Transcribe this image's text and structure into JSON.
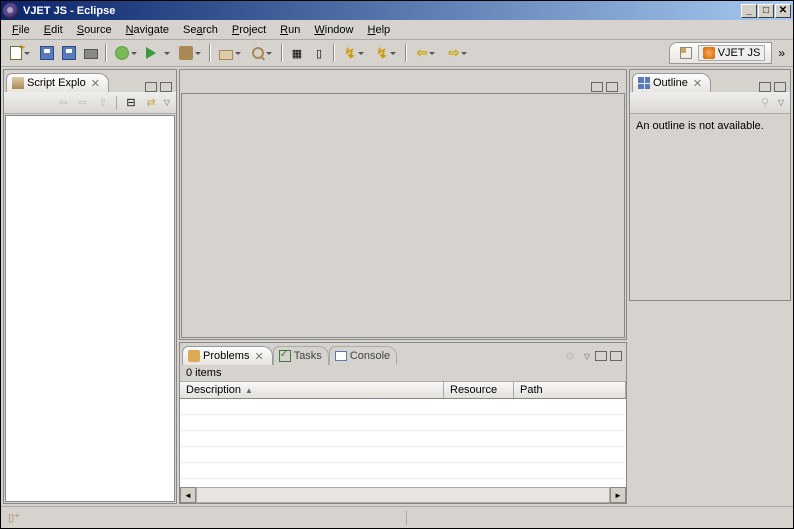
{
  "window": {
    "title": "VJET JS - Eclipse"
  },
  "menu": {
    "file": "File",
    "edit": "Edit",
    "source": "Source",
    "navigate": "Navigate",
    "search": "Search",
    "project": "Project",
    "run": "Run",
    "window": "Window",
    "help": "Help"
  },
  "perspective": {
    "label": "VJET JS"
  },
  "views": {
    "scriptExplorer": {
      "title": "Script Explo"
    },
    "outline": {
      "title": "Outline",
      "body": "An outline is not available."
    },
    "problems": {
      "title": "Problems",
      "items": "0 items"
    },
    "tasks": {
      "title": "Tasks"
    },
    "console": {
      "title": "Console"
    }
  },
  "table": {
    "cols": {
      "description": "Description",
      "resource": "Resource",
      "path": "Path"
    }
  }
}
